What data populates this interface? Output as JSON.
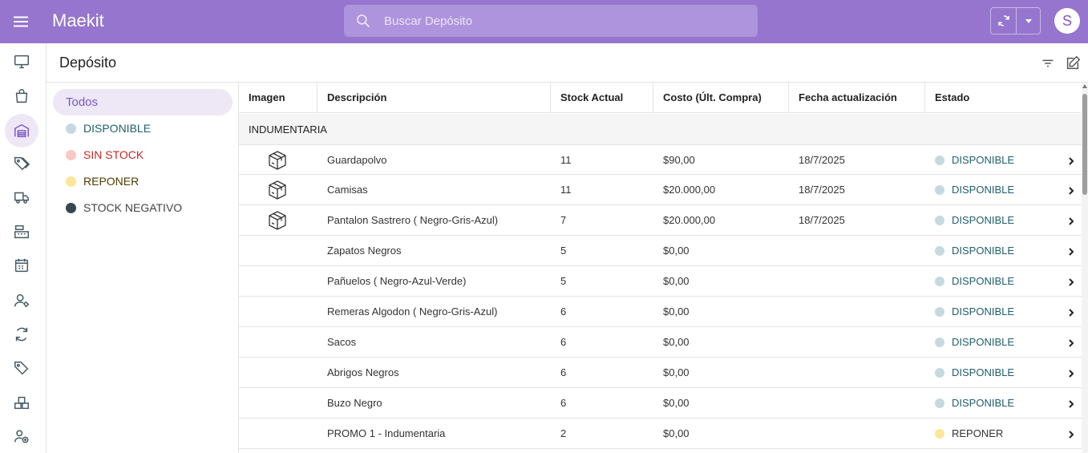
{
  "app": {
    "title": "Maekit"
  },
  "search": {
    "placeholder": "Buscar Depósito"
  },
  "user": {
    "initial": "S"
  },
  "page": {
    "title": "Depósito"
  },
  "colors": {
    "brand": "#9575cd",
    "accent": "#7e57c2",
    "disponible": "#c5d9e0",
    "sin_stock": "#f8c8c8",
    "reponer": "#fbe69a",
    "negativo": "#37474f"
  },
  "filters": {
    "all_label": "Todos",
    "items": [
      {
        "label": "DISPONIBLE",
        "color": "#c5d9e0",
        "text_color": "#1f5f6b"
      },
      {
        "label": "SIN STOCK",
        "color": "#f8c8c8",
        "text_color": "#c62828"
      },
      {
        "label": "REPONER",
        "color": "#fbe69a",
        "text_color": "#4e3b00"
      },
      {
        "label": "STOCK NEGATIVO",
        "color": "#37474f",
        "text_color": "#444444"
      }
    ]
  },
  "table": {
    "columns": [
      "Imagen",
      "Descripción",
      "Stock Actual",
      "Costo (Últ. Compra)",
      "Fecha actualización",
      "Estado"
    ],
    "group": "INDUMENTARIA",
    "rows": [
      {
        "image": "box-icon",
        "descripcion": "Guardapolvo",
        "stock": "11",
        "costo": "$90,00",
        "fecha": "18/7/2025",
        "estado": "DISPONIBLE"
      },
      {
        "image": "box-icon",
        "descripcion": "Camisas",
        "stock": "11",
        "costo": "$20.000,00",
        "fecha": "18/7/2025",
        "estado": "DISPONIBLE"
      },
      {
        "image": "box-icon",
        "descripcion": "Pantalon Sastrero ( Negro-Gris-Azul)",
        "stock": "7",
        "costo": "$20.000,00",
        "fecha": "18/7/2025",
        "estado": "DISPONIBLE"
      },
      {
        "image": "",
        "descripcion": "Zapatos Negros",
        "stock": "5",
        "costo": "$0,00",
        "fecha": "",
        "estado": "DISPONIBLE"
      },
      {
        "image": "",
        "descripcion": "Pañuelos ( Negro-Azul-Verde)",
        "stock": "5",
        "costo": "$0,00",
        "fecha": "",
        "estado": "DISPONIBLE"
      },
      {
        "image": "",
        "descripcion": "Remeras Algodon ( Negro-Gris-Azul)",
        "stock": "6",
        "costo": "$0,00",
        "fecha": "",
        "estado": "DISPONIBLE"
      },
      {
        "image": "",
        "descripcion": "Sacos",
        "stock": "6",
        "costo": "$0,00",
        "fecha": "",
        "estado": "DISPONIBLE"
      },
      {
        "image": "",
        "descripcion": "Abrigos Negros",
        "stock": "6",
        "costo": "$0,00",
        "fecha": "",
        "estado": "DISPONIBLE"
      },
      {
        "image": "",
        "descripcion": "Buzo Negro",
        "stock": "6",
        "costo": "$0,00",
        "fecha": "",
        "estado": "DISPONIBLE"
      },
      {
        "image": "",
        "descripcion": "PROMO 1 - Indumentaria",
        "stock": "2",
        "costo": "$0,00",
        "fecha": "",
        "estado": "REPONER"
      }
    ]
  },
  "rail": [
    "monitor-icon",
    "shopping-bag-icon",
    "warehouse-icon",
    "tags-icon",
    "truck-icon",
    "cash-register-icon",
    "calendar-icon",
    "user-tag-icon",
    "refresh-icon",
    "tag-icon",
    "boxes-icon",
    "users-add-icon"
  ]
}
